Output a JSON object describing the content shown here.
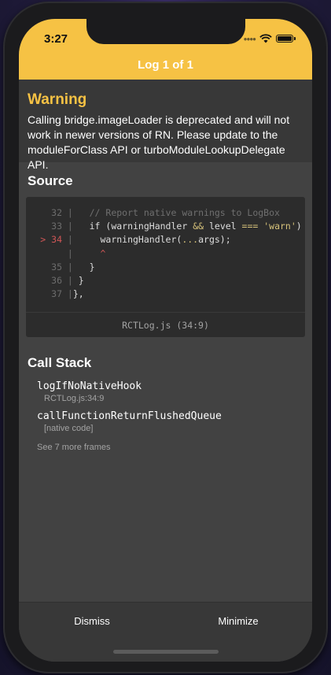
{
  "status_bar": {
    "time": "3:27"
  },
  "header": {
    "title": "Log 1 of 1"
  },
  "warning": {
    "title": "Warning",
    "message": "Calling bridge.imageLoader is deprecated and will not work in newer versions of RN. Please update to the moduleForClass API or turboModuleLookupDelegate API."
  },
  "source": {
    "title": "Source",
    "file_location": "RCTLog.js (34:9)",
    "lines": [
      {
        "number": "32",
        "text": "// Report native warnings to LogBox"
      },
      {
        "number": "33",
        "text": "if (warningHandler && level === 'warn') {"
      },
      {
        "number": "34",
        "text": "warningHandler(...args);"
      },
      {
        "number": "",
        "text": "^"
      },
      {
        "number": "35",
        "text": "}"
      },
      {
        "number": "36",
        "text": "}"
      },
      {
        "number": "37",
        "text": "},"
      }
    ],
    "active_marker": ">"
  },
  "call_stack": {
    "title": "Call Stack",
    "frames": [
      {
        "name": "logIfNoNativeHook",
        "location": "RCTLog.js:34:9"
      },
      {
        "name": "callFunctionReturnFlushedQueue",
        "location": "[native code]"
      }
    ],
    "more_frames": "See 7 more frames"
  },
  "footer": {
    "dismiss_label": "Dismiss",
    "minimize_label": "Minimize"
  },
  "colors": {
    "accent": "#f6c244",
    "background": "#424242",
    "panel": "#383838",
    "code_bg": "#2c2c2c"
  }
}
